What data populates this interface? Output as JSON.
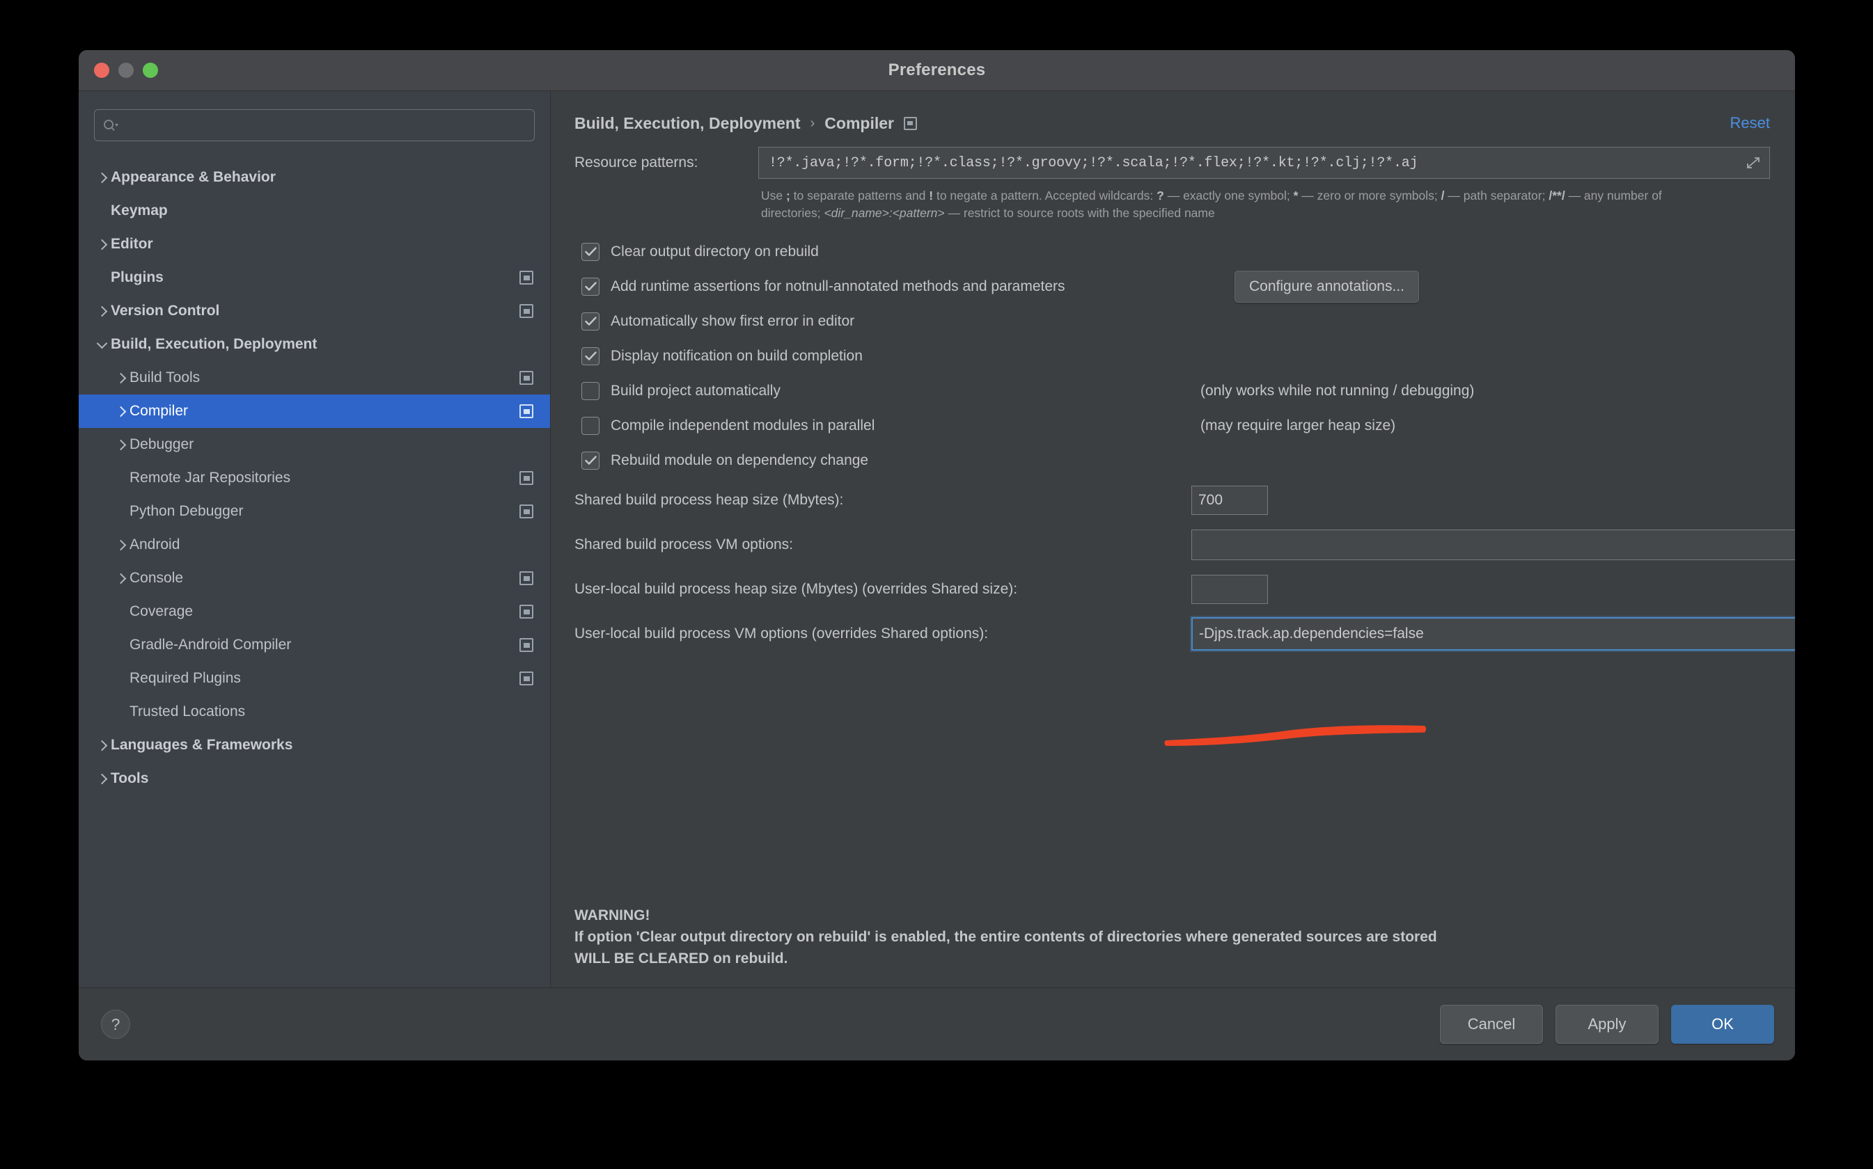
{
  "window": {
    "title": "Preferences",
    "traffic_lights": [
      "close-button",
      "minimize-button",
      "zoom-button"
    ]
  },
  "sidebar": {
    "search": {
      "value": "",
      "placeholder": ""
    },
    "items": [
      {
        "label": "Appearance & Behavior",
        "level": 0,
        "arrow": "right",
        "project_icon": false,
        "selected": false
      },
      {
        "label": "Keymap",
        "level": 0,
        "arrow": "none",
        "project_icon": false,
        "selected": false
      },
      {
        "label": "Editor",
        "level": 0,
        "arrow": "right",
        "project_icon": false,
        "selected": false
      },
      {
        "label": "Plugins",
        "level": 0,
        "arrow": "none",
        "project_icon": true,
        "selected": false
      },
      {
        "label": "Version Control",
        "level": 0,
        "arrow": "right",
        "project_icon": true,
        "selected": false
      },
      {
        "label": "Build, Execution, Deployment",
        "level": 0,
        "arrow": "down",
        "project_icon": false,
        "selected": false
      },
      {
        "label": "Build Tools",
        "level": 1,
        "arrow": "right",
        "project_icon": true,
        "selected": false
      },
      {
        "label": "Compiler",
        "level": 1,
        "arrow": "right",
        "project_icon": true,
        "selected": true
      },
      {
        "label": "Debugger",
        "level": 1,
        "arrow": "right",
        "project_icon": false,
        "selected": false
      },
      {
        "label": "Remote Jar Repositories",
        "level": 1,
        "arrow": "none",
        "project_icon": true,
        "selected": false
      },
      {
        "label": "Python Debugger",
        "level": 1,
        "arrow": "none",
        "project_icon": true,
        "selected": false
      },
      {
        "label": "Android",
        "level": 1,
        "arrow": "right",
        "project_icon": false,
        "selected": false
      },
      {
        "label": "Console",
        "level": 1,
        "arrow": "right",
        "project_icon": true,
        "selected": false
      },
      {
        "label": "Coverage",
        "level": 1,
        "arrow": "none",
        "project_icon": true,
        "selected": false
      },
      {
        "label": "Gradle-Android Compiler",
        "level": 1,
        "arrow": "none",
        "project_icon": true,
        "selected": false
      },
      {
        "label": "Required Plugins",
        "level": 1,
        "arrow": "none",
        "project_icon": true,
        "selected": false
      },
      {
        "label": "Trusted Locations",
        "level": 1,
        "arrow": "none",
        "project_icon": false,
        "selected": false
      },
      {
        "label": "Languages & Frameworks",
        "level": 0,
        "arrow": "right",
        "project_icon": false,
        "selected": false
      },
      {
        "label": "Tools",
        "level": 0,
        "arrow": "right",
        "project_icon": false,
        "selected": false
      }
    ]
  },
  "main": {
    "breadcrumb": {
      "parent": "Build, Execution, Deployment",
      "separator": "›",
      "current": "Compiler"
    },
    "reset_label": "Reset",
    "resource_patterns": {
      "label": "Resource patterns:",
      "value": "!?*.java;!?*.form;!?*.class;!?*.groovy;!?*.scala;!?*.flex;!?*.kt;!?*.clj;!?*.aj"
    },
    "hint": {
      "l1_a": "Use ",
      "l1_semicolon": ";",
      "l1_b": " to separate patterns and ",
      "l1_bang": "!",
      "l1_c": " to negate a pattern. Accepted wildcards: ",
      "l1_q": "?",
      "l1_d": " — exactly one symbol; ",
      "l1_star": "*",
      "l1_e": " — zero or more symbols; ",
      "l1_slash": "/",
      "l1_f": " — path",
      "l2_a": "separator; ",
      "l2_dstar": "/**/",
      "l2_b": " — any number of directories; ",
      "l2_dir": "<dir_name>:<pattern>",
      "l2_c": " — restrict to source roots with the specified name"
    },
    "checkboxes": [
      {
        "label": "Clear output directory on rebuild",
        "checked": true,
        "note": "",
        "button": ""
      },
      {
        "label": "Add runtime assertions for notnull-annotated methods and parameters",
        "checked": true,
        "note": "",
        "button": "Configure annotations..."
      },
      {
        "label": "Automatically show first error in editor",
        "checked": true,
        "note": "",
        "button": ""
      },
      {
        "label": "Display notification on build completion",
        "checked": true,
        "note": "",
        "button": ""
      },
      {
        "label": "Build project automatically",
        "checked": false,
        "note": "(only works while not running / debugging)",
        "button": ""
      },
      {
        "label": "Compile independent modules in parallel",
        "checked": false,
        "note": "(may require larger heap size)",
        "button": ""
      },
      {
        "label": "Rebuild module on dependency change",
        "checked": true,
        "note": "",
        "button": ""
      }
    ],
    "fields": [
      {
        "label": "Shared build process heap size (Mbytes):",
        "value": "700",
        "size": "small",
        "focused": false
      },
      {
        "label": "Shared build process VM options:",
        "value": "",
        "size": "wide",
        "focused": false
      },
      {
        "label": "User-local build process heap size (Mbytes) (overrides Shared size):",
        "value": "",
        "size": "small",
        "focused": false
      },
      {
        "label": "User-local build process VM options (overrides Shared options):",
        "value": "-Djps.track.ap.dependencies=false",
        "size": "wide",
        "focused": true
      }
    ],
    "annotation_color": "#ee4323",
    "warning": {
      "line1": "WARNING!",
      "line2": "If option 'Clear output directory on rebuild' is enabled, the entire contents of directories where generated sources are stored",
      "line3": "WILL BE CLEARED on rebuild."
    }
  },
  "footer": {
    "help_label": "?",
    "cancel_label": "Cancel",
    "apply_label": "Apply",
    "ok_label": "OK"
  },
  "colors": {
    "accent_blue": "#2f65c9",
    "link_blue": "#4a90e2",
    "focus_blue": "#4a88c7",
    "ok_button": "#3a6ea5",
    "annotation_red": "#ee4323",
    "sidebar_bg": "#3c4148",
    "main_bg": "#3c3f41",
    "titlebar_bg": "#46474a"
  }
}
